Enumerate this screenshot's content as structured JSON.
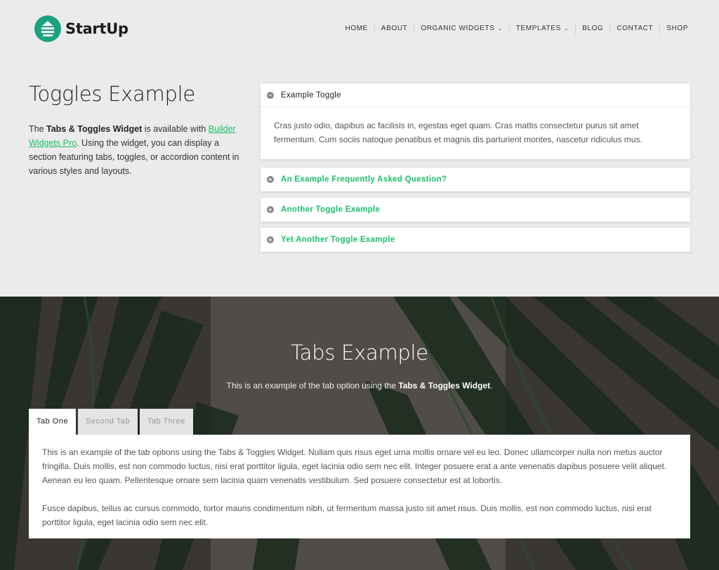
{
  "header": {
    "logo_text": "StartUp",
    "nav": [
      {
        "label": "HOME",
        "dropdown": false
      },
      {
        "label": "ABOUT",
        "dropdown": false
      },
      {
        "label": "ORGANIC WIDGETS",
        "dropdown": true
      },
      {
        "label": "TEMPLATES",
        "dropdown": true
      },
      {
        "label": "BLOG",
        "dropdown": false
      },
      {
        "label": "CONTACT",
        "dropdown": false
      },
      {
        "label": "SHOP",
        "dropdown": false
      }
    ]
  },
  "toggles": {
    "title": "Toggles Example",
    "desc_prefix": "The ",
    "desc_bold": "Tabs & Toggles Widget",
    "desc_mid": " is available with ",
    "desc_link": "Builder Widgets Pro",
    "desc_suffix": ". Using the widget, you can display a section featuring tabs, toggles, or accordion content in various styles and layouts.",
    "items": [
      {
        "label": "Example Toggle",
        "open": true,
        "body": "Cras justo odio, dapibus ac facilisis in, egestas eget quam. Cras mattis consectetur purus sit amet fermentum. Cum sociis natoque penatibus et magnis dis parturient montes, nascetur ridiculus mus."
      },
      {
        "label": "An Example Frequently Asked Question?",
        "open": false
      },
      {
        "label": "Another Toggle Example",
        "open": false
      },
      {
        "label": "Yet Another Toggle Example",
        "open": false
      }
    ]
  },
  "tabs": {
    "title": "Tabs Example",
    "sub_prefix": "This is an example of the tab option using the ",
    "sub_bold": "Tabs & Toggles Widget",
    "sub_suffix": ".",
    "items": [
      {
        "label": "Tab One",
        "active": true
      },
      {
        "label": "Second Tab",
        "active": false
      },
      {
        "label": "Tab Three",
        "active": false
      }
    ],
    "panel_p1": "This is an example of the tab options using the Tabs & Toggles Widget. Nullam quis risus eget urna mollis ornare vel eu leo. Donec ullamcorper nulla non metus auctor fringilla. Duis mollis, est non commodo luctus, nisi erat porttitor ligula, eget lacinia odio sem nec elit. Integer posuere erat a ante venenatis dapibus posuere velit aliquet. Aenean eu leo quam. Pellentesque ornare sem lacinia quam venenatis vestibulum. Sed posuere consectetur est at lobortis.",
    "panel_p2": "Fusce dapibus, tellus ac cursus commodo, tortor mauris condimentum nibh, ut fermentum massa justo sit amet risus. Duis mollis, est non commodo luctus, nisi erat porttitor ligula, eget lacinia odio sem nec elit."
  },
  "colors": {
    "accent": "#1bbf6a",
    "logo": "#1aa37e"
  }
}
